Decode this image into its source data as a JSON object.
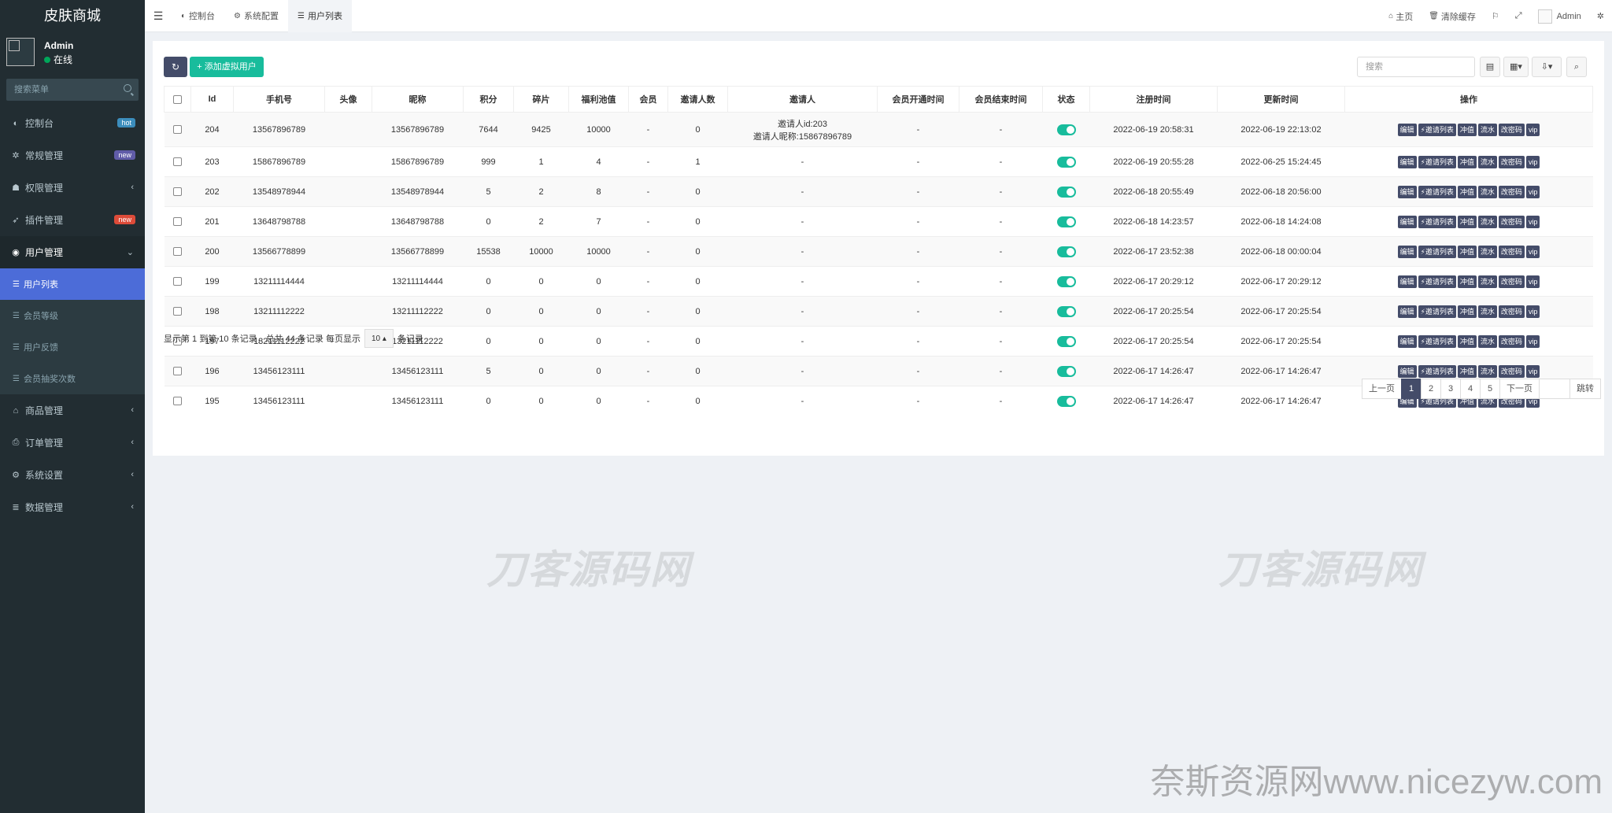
{
  "brand": "皮肤商城",
  "user": {
    "name": "Admin",
    "status": "在线"
  },
  "side_search_placeholder": "搜索菜单",
  "menu": [
    {
      "label": "控制台",
      "badge": "hot",
      "badge_color": "#3c8dbc"
    },
    {
      "label": "常规管理",
      "badge": "new",
      "badge_color": "#605ca8"
    },
    {
      "label": "权限管理",
      "chevron": "‹"
    },
    {
      "label": "插件管理",
      "badge": "new",
      "badge_color": "#dd4b39"
    },
    {
      "label": "用户管理",
      "chevron": "⌄"
    }
  ],
  "submenu": [
    "用户列表",
    "会员等级",
    "用户反馈",
    "会员抽奖次数"
  ],
  "menu_after": [
    "商品管理",
    "订单管理",
    "系统设置",
    "数据管理"
  ],
  "tabs": [
    "控制台",
    "系统配置",
    "用户列表"
  ],
  "top_right": {
    "home": "主页",
    "clear_cache": "清除缓存",
    "admin": "Admin"
  },
  "toolbar": {
    "add_label": "添加虚拟用户",
    "search_placeholder": "搜索"
  },
  "table": {
    "headers": [
      "Id",
      "手机号",
      "头像",
      "昵称",
      "积分",
      "碎片",
      "福利池值",
      "会员",
      "邀请人数",
      "邀请人",
      "会员开通时间",
      "会员结束时间",
      "状态",
      "注册时间",
      "更新时间",
      "操作"
    ],
    "rows": [
      {
        "id": "204",
        "phone": "13567896789",
        "avatar": "",
        "nick": "13567896789",
        "points": "7644",
        "frag": "9425",
        "pool": "10000",
        "vip": "-",
        "invites": "0",
        "inviter1": "邀请人id:203",
        "inviter2": "邀请人昵称:15867896789",
        "vstart": "-",
        "vend": "-",
        "reg": "2022-06-19 20:58:31",
        "upd": "2022-06-19 22:13:02"
      },
      {
        "id": "203",
        "phone": "15867896789",
        "avatar": "",
        "nick": "15867896789",
        "points": "999",
        "frag": "1",
        "pool": "4",
        "vip": "-",
        "invites": "1",
        "inviter1": "-",
        "inviter2": "",
        "vstart": "-",
        "vend": "-",
        "reg": "2022-06-19 20:55:28",
        "upd": "2022-06-25 15:24:45"
      },
      {
        "id": "202",
        "phone": "13548978944",
        "avatar": "",
        "nick": "13548978944",
        "points": "5",
        "frag": "2",
        "pool": "8",
        "vip": "-",
        "invites": "0",
        "inviter1": "-",
        "inviter2": "",
        "vstart": "-",
        "vend": "-",
        "reg": "2022-06-18 20:55:49",
        "upd": "2022-06-18 20:56:00"
      },
      {
        "id": "201",
        "phone": "13648798788",
        "avatar": "",
        "nick": "13648798788",
        "points": "0",
        "frag": "2",
        "pool": "7",
        "vip": "-",
        "invites": "0",
        "inviter1": "-",
        "inviter2": "",
        "vstart": "-",
        "vend": "-",
        "reg": "2022-06-18 14:23:57",
        "upd": "2022-06-18 14:24:08"
      },
      {
        "id": "200",
        "phone": "13566778899",
        "avatar": "",
        "nick": "13566778899",
        "points": "15538",
        "frag": "10000",
        "pool": "10000",
        "vip": "-",
        "invites": "0",
        "inviter1": "-",
        "inviter2": "",
        "vstart": "-",
        "vend": "-",
        "reg": "2022-06-17 23:52:38",
        "upd": "2022-06-18 00:00:04"
      },
      {
        "id": "199",
        "phone": "13211114444",
        "avatar": "",
        "nick": "13211114444",
        "points": "0",
        "frag": "0",
        "pool": "0",
        "vip": "-",
        "invites": "0",
        "inviter1": "-",
        "inviter2": "",
        "vstart": "-",
        "vend": "-",
        "reg": "2022-06-17 20:29:12",
        "upd": "2022-06-17 20:29:12"
      },
      {
        "id": "198",
        "phone": "13211112222",
        "avatar": "",
        "nick": "13211112222",
        "points": "0",
        "frag": "0",
        "pool": "0",
        "vip": "-",
        "invites": "0",
        "inviter1": "-",
        "inviter2": "",
        "vstart": "-",
        "vend": "-",
        "reg": "2022-06-17 20:25:54",
        "upd": "2022-06-17 20:25:54"
      },
      {
        "id": "197",
        "phone": "13211112222",
        "avatar": "",
        "nick": "13211112222",
        "points": "0",
        "frag": "0",
        "pool": "0",
        "vip": "-",
        "invites": "0",
        "inviter1": "-",
        "inviter2": "",
        "vstart": "-",
        "vend": "-",
        "reg": "2022-06-17 20:25:54",
        "upd": "2022-06-17 20:25:54"
      },
      {
        "id": "196",
        "phone": "13456123111",
        "avatar": "",
        "nick": "13456123111",
        "points": "5",
        "frag": "0",
        "pool": "0",
        "vip": "-",
        "invites": "0",
        "inviter1": "-",
        "inviter2": "",
        "vstart": "-",
        "vend": "-",
        "reg": "2022-06-17 14:26:47",
        "upd": "2022-06-17 14:26:47"
      },
      {
        "id": "195",
        "phone": "13456123111",
        "avatar": "",
        "nick": "13456123111",
        "points": "0",
        "frag": "0",
        "pool": "0",
        "vip": "-",
        "invites": "0",
        "inviter1": "-",
        "inviter2": "",
        "vstart": "-",
        "vend": "-",
        "reg": "2022-06-17 14:26:47",
        "upd": "2022-06-17 14:26:47"
      }
    ],
    "ops": [
      "编辑",
      "邀请列表",
      "冲值",
      "流水",
      "改密码",
      "vip"
    ]
  },
  "footer": {
    "info": "显示第 1 到第 10 条记录，总共 44 条记录 每页显示",
    "pagesize": "10",
    "suffix": "条记录"
  },
  "pager": {
    "prev": "上一页",
    "pages": [
      "1",
      "2",
      "3",
      "4",
      "5"
    ],
    "next": "下一页",
    "jump": "跳转"
  },
  "watermarks": {
    "center": "刀客源码网",
    "bottom": "奈斯资源网www.nicezyw.com"
  },
  "colors": {
    "sidebar": "#222d32",
    "active_menu": "#4c6cd8",
    "primary_btn": "#444c69",
    "success": "#18bc9c"
  }
}
